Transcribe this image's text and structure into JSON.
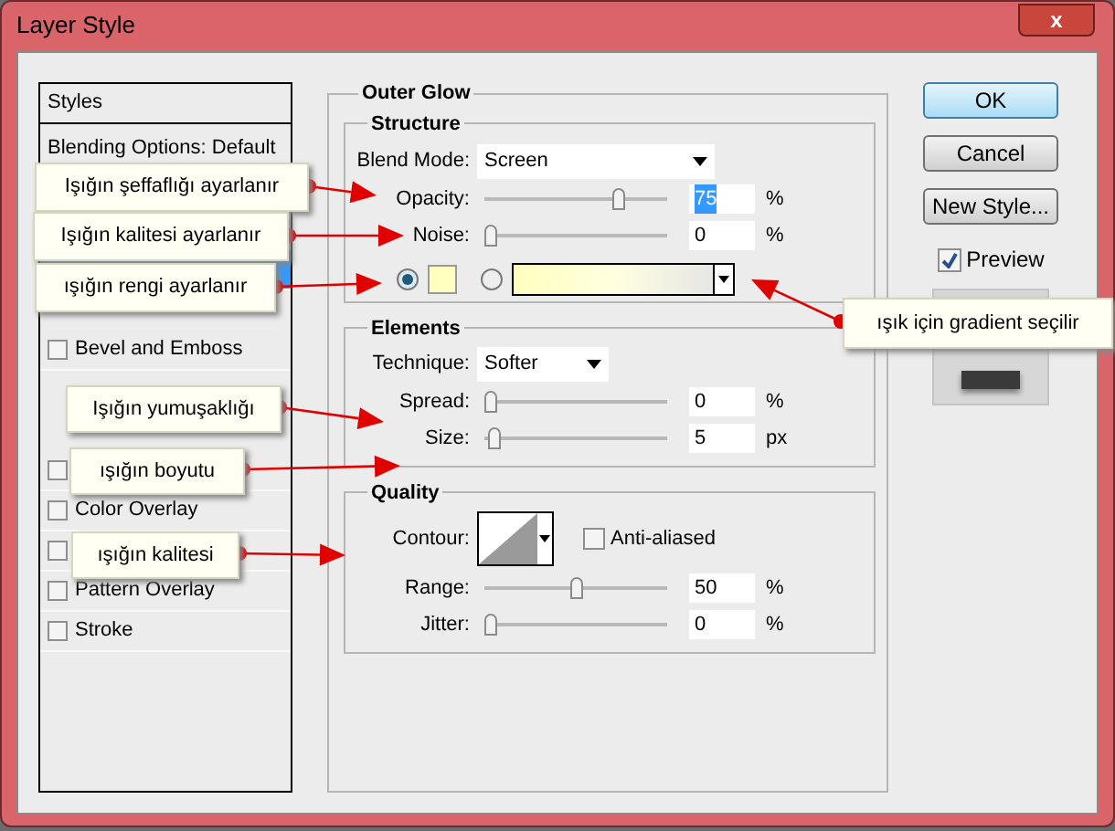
{
  "window": {
    "title": "Layer Style",
    "close": "x"
  },
  "sidebar": {
    "header": "Styles",
    "items": [
      {
        "kind": "plain",
        "label": "Blending Options: Default",
        "selected": false
      },
      {
        "kind": "blank",
        "selected": true
      },
      {
        "kind": "checkbox",
        "label": "Bevel and Emboss",
        "checked": false,
        "selected": false
      },
      {
        "kind": "checkbox",
        "checked": false,
        "selected": false
      },
      {
        "kind": "checkbox",
        "label": "Color Overlay",
        "checked": false,
        "selected": false
      },
      {
        "kind": "checkbox",
        "checked": false,
        "selected": false
      },
      {
        "kind": "checkbox",
        "label": "Pattern Overlay",
        "checked": false,
        "selected": false
      },
      {
        "kind": "checkbox",
        "label": "Stroke",
        "checked": false,
        "selected": false
      }
    ]
  },
  "panel": {
    "title": "Outer Glow",
    "structure": {
      "title": "Structure",
      "blend_mode": {
        "label": "Blend Mode:",
        "value": "Screen"
      },
      "sliders": [
        {
          "label": "Opacity:",
          "level": 0.75,
          "value": "75",
          "unit": "%",
          "highlighted": true
        },
        {
          "label": "Noise:",
          "level": 0,
          "value": "0",
          "unit": "%",
          "highlighted": false
        }
      ],
      "fill_options": [
        {
          "kind": "color",
          "selected": true
        },
        {
          "kind": "gradient",
          "selected": false
        }
      ]
    },
    "elements": {
      "title": "Elements",
      "technique": {
        "label": "Technique:",
        "value": "Softer"
      },
      "sliders": [
        {
          "label": "Spread:",
          "level": 0,
          "value": "0",
          "unit": "%",
          "highlighted": false
        },
        {
          "label": "Size:",
          "level": 0.02,
          "value": "5",
          "unit": "px",
          "highlighted": false
        }
      ]
    },
    "quality": {
      "title": "Quality",
      "contour": {
        "label": "Contour:"
      },
      "anti_aliased": {
        "label": "Anti-aliased",
        "checked": false
      },
      "sliders": [
        {
          "label": "Range:",
          "level": 0.5,
          "value": "50",
          "unit": "%",
          "highlighted": false
        },
        {
          "label": "Jitter:",
          "level": 0,
          "value": "0",
          "unit": "%",
          "highlighted": false
        }
      ]
    }
  },
  "buttons": [
    {
      "label": "OK",
      "default": true
    },
    {
      "label": "Cancel",
      "default": false
    },
    {
      "label": "New Style...",
      "default": false
    }
  ],
  "preview": {
    "label": "Preview",
    "checked": true
  },
  "callouts": [
    {
      "text": "Işığın şeffaflığı ayarlanır"
    },
    {
      "text": "Işığın kalitesi ayarlanır"
    },
    {
      "text": "ışığın rengi ayarlanır"
    },
    {
      "text": "ışık için gradient seçilir"
    },
    {
      "text": "Işığın yumuşaklığı"
    },
    {
      "text": "ışığın boyutu"
    },
    {
      "text": "ışığın kalitesi"
    }
  ]
}
